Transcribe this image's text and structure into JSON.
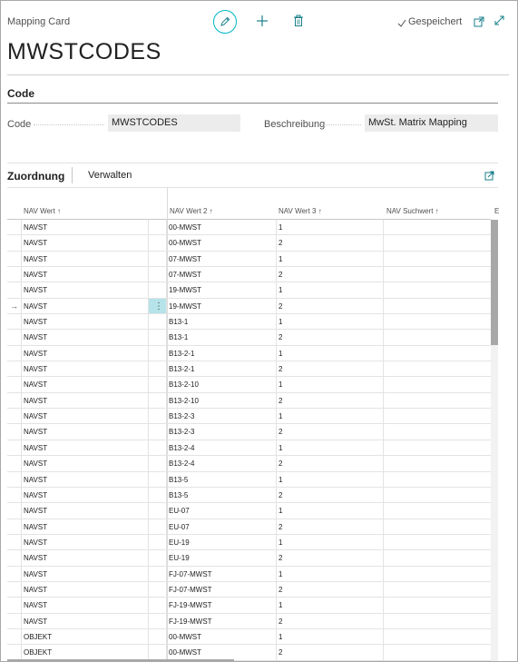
{
  "header": {
    "caption": "Mapping Card",
    "saved_label": "Gespeichert",
    "title": "MWSTCODES"
  },
  "code_section": {
    "heading": "Code",
    "code_label": "Code",
    "code_value": "MWSTCODES",
    "desc_label": "Beschreibung",
    "desc_value": "MwSt. Matrix Mapping"
  },
  "tabs": {
    "zuordnung": "Zuordnung",
    "verwalten": "Verwalten"
  },
  "table": {
    "headers": [
      "NAV Wert ↑",
      "NAV Wert 2 ↑",
      "NAV Wert 3 ↑",
      "NAV Suchwert ↑",
      "E"
    ],
    "selected_row_index": 5,
    "rows": [
      {
        "c1": "NAVST",
        "c2": "00-MWST",
        "c3": "1"
      },
      {
        "c1": "NAVST",
        "c2": "00-MWST",
        "c3": "2"
      },
      {
        "c1": "NAVST",
        "c2": "07-MWST",
        "c3": "1"
      },
      {
        "c1": "NAVST",
        "c2": "07-MWST",
        "c3": "2"
      },
      {
        "c1": "NAVST",
        "c2": "19-MWST",
        "c3": "1"
      },
      {
        "c1": "NAVST",
        "c2": "19-MWST",
        "c3": "2"
      },
      {
        "c1": "NAVST",
        "c2": "B13-1",
        "c3": "1"
      },
      {
        "c1": "NAVST",
        "c2": "B13-1",
        "c3": "2"
      },
      {
        "c1": "NAVST",
        "c2": "B13-2-1",
        "c3": "1"
      },
      {
        "c1": "NAVST",
        "c2": "B13-2-1",
        "c3": "2"
      },
      {
        "c1": "NAVST",
        "c2": "B13-2-10",
        "c3": "1"
      },
      {
        "c1": "NAVST",
        "c2": "B13-2-10",
        "c3": "2"
      },
      {
        "c1": "NAVST",
        "c2": "B13-2-3",
        "c3": "1"
      },
      {
        "c1": "NAVST",
        "c2": "B13-2-3",
        "c3": "2"
      },
      {
        "c1": "NAVST",
        "c2": "B13-2-4",
        "c3": "1"
      },
      {
        "c1": "NAVST",
        "c2": "B13-2-4",
        "c3": "2"
      },
      {
        "c1": "NAVST",
        "c2": "B13-5",
        "c3": "1"
      },
      {
        "c1": "NAVST",
        "c2": "B13-5",
        "c3": "2"
      },
      {
        "c1": "NAVST",
        "c2": "EU-07",
        "c3": "1"
      },
      {
        "c1": "NAVST",
        "c2": "EU-07",
        "c3": "2"
      },
      {
        "c1": "NAVST",
        "c2": "EU-19",
        "c3": "1"
      },
      {
        "c1": "NAVST",
        "c2": "EU-19",
        "c3": "2"
      },
      {
        "c1": "NAVST",
        "c2": "FJ-07-MWST",
        "c3": "1"
      },
      {
        "c1": "NAVST",
        "c2": "FJ-07-MWST",
        "c3": "2"
      },
      {
        "c1": "NAVST",
        "c2": "FJ-19-MWST",
        "c3": "1"
      },
      {
        "c1": "NAVST",
        "c2": "FJ-19-MWST",
        "c3": "2"
      },
      {
        "c1": "OBJEKT",
        "c2": "00-MWST",
        "c3": "1"
      },
      {
        "c1": "OBJEKT",
        "c2": "00-MWST",
        "c3": "2"
      }
    ]
  },
  "icons": {
    "edit": "pencil-icon",
    "new": "plus-icon",
    "delete": "trash-icon",
    "saved": "check-icon",
    "popout": "open-new-window-icon",
    "fullscreen": "expand-icon",
    "expand_part": "expand-part-icon",
    "row_marker": "arrow-right-icon",
    "row_menu": "kebab-icon"
  },
  "colors": {
    "accent": "#00b7c3",
    "selected_cell": "#b6e3ea"
  }
}
